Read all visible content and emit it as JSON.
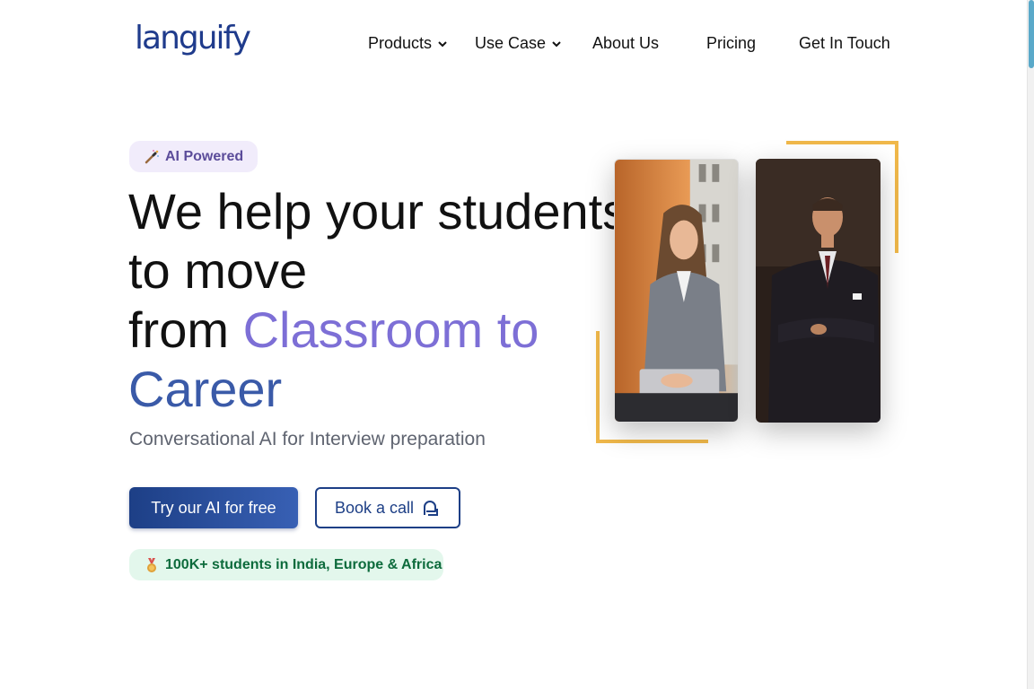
{
  "brand": {
    "name": "languify",
    "color": "#1f3b8c"
  },
  "nav": {
    "items": [
      {
        "label": "Products",
        "dropdown": true
      },
      {
        "label": "Use Case",
        "dropdown": true
      },
      {
        "label": "About Us",
        "dropdown": false
      },
      {
        "label": "Pricing",
        "dropdown": false
      },
      {
        "label": "Get In Touch",
        "dropdown": false
      }
    ]
  },
  "hero": {
    "badge": {
      "label": "AI Powered",
      "icon": "magic-wand-icon"
    },
    "headline": {
      "line1": "We help your students",
      "line2": "to move",
      "line3_prefix": "from ",
      "line3_highlight": "Classroom to",
      "line4_highlight": "Career"
    },
    "subheadline": "Conversational AI for Interview preparation",
    "primary_cta": "Try our AI for free",
    "secondary_cta": "Book a call",
    "secondary_cta_icon": "chat-bubble-icon",
    "social_proof": {
      "label": "100K+ students in India, Europe & Africa",
      "icon": "medal-icon"
    },
    "images": [
      {
        "name": "photo-woman-student",
        "alt": "Smiling woman in grey blazer holding laptop"
      },
      {
        "name": "photo-man-professional",
        "alt": "Man in dark suit with arms crossed"
      }
    ]
  },
  "colors": {
    "accent_purple": "#7d6fd6",
    "accent_blue": "#3a5aa8",
    "primary_button": "#1d3f86",
    "frame_gold": "#f0b84a",
    "badge_purple_bg": "#f1ecfb",
    "badge_green_bg": "#e3f7ec"
  }
}
